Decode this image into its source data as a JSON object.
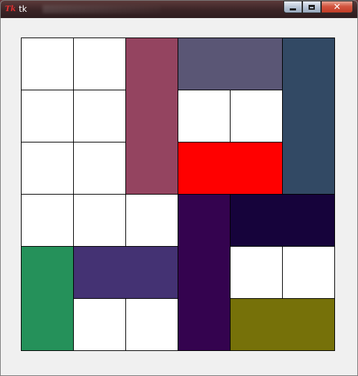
{
  "window": {
    "title": "tk",
    "app_icon": "Tk",
    "controls": [
      "minimize",
      "maximize",
      "close"
    ]
  },
  "board": {
    "grid_size": 6,
    "empty_color": "#ffffff",
    "cells": [
      {
        "row": 0,
        "col": 0
      },
      {
        "row": 0,
        "col": 1
      },
      {
        "row": 1,
        "col": 0
      },
      {
        "row": 1,
        "col": 1
      },
      {
        "row": 1,
        "col": 3
      },
      {
        "row": 1,
        "col": 4
      },
      {
        "row": 2,
        "col": 0
      },
      {
        "row": 2,
        "col": 1
      },
      {
        "row": 3,
        "col": 0
      },
      {
        "row": 3,
        "col": 1
      },
      {
        "row": 3,
        "col": 2
      },
      {
        "row": 4,
        "col": 4
      },
      {
        "row": 4,
        "col": 5
      },
      {
        "row": 5,
        "col": 1
      },
      {
        "row": 5,
        "col": 2
      }
    ],
    "pieces": [
      {
        "name": "piece-maroon-vertical",
        "color": "#944460",
        "row": 0,
        "col": 2,
        "rows": 3,
        "cols": 1
      },
      {
        "name": "piece-slate-horizontal",
        "color": "#5a5675",
        "row": 0,
        "col": 3,
        "rows": 1,
        "cols": 2
      },
      {
        "name": "piece-navy-vertical",
        "color": "#324964",
        "row": 0,
        "col": 5,
        "rows": 3,
        "cols": 1
      },
      {
        "name": "piece-red-target",
        "color": "#ff0000",
        "row": 2,
        "col": 3,
        "rows": 1,
        "cols": 2
      },
      {
        "name": "piece-purple-vertical",
        "color": "#34034f",
        "row": 3,
        "col": 3,
        "rows": 3,
        "cols": 1
      },
      {
        "name": "piece-dark-indigo-horizontal",
        "color": "#16033b",
        "row": 3,
        "col": 4,
        "rows": 1,
        "cols": 2
      },
      {
        "name": "piece-green-vertical",
        "color": "#25915a",
        "row": 4,
        "col": 0,
        "rows": 2,
        "cols": 1
      },
      {
        "name": "piece-violet-horizontal",
        "color": "#443273",
        "row": 4,
        "col": 1,
        "rows": 1,
        "cols": 2
      },
      {
        "name": "piece-olive-horizontal",
        "color": "#767109",
        "row": 5,
        "col": 4,
        "rows": 1,
        "cols": 2
      }
    ]
  }
}
